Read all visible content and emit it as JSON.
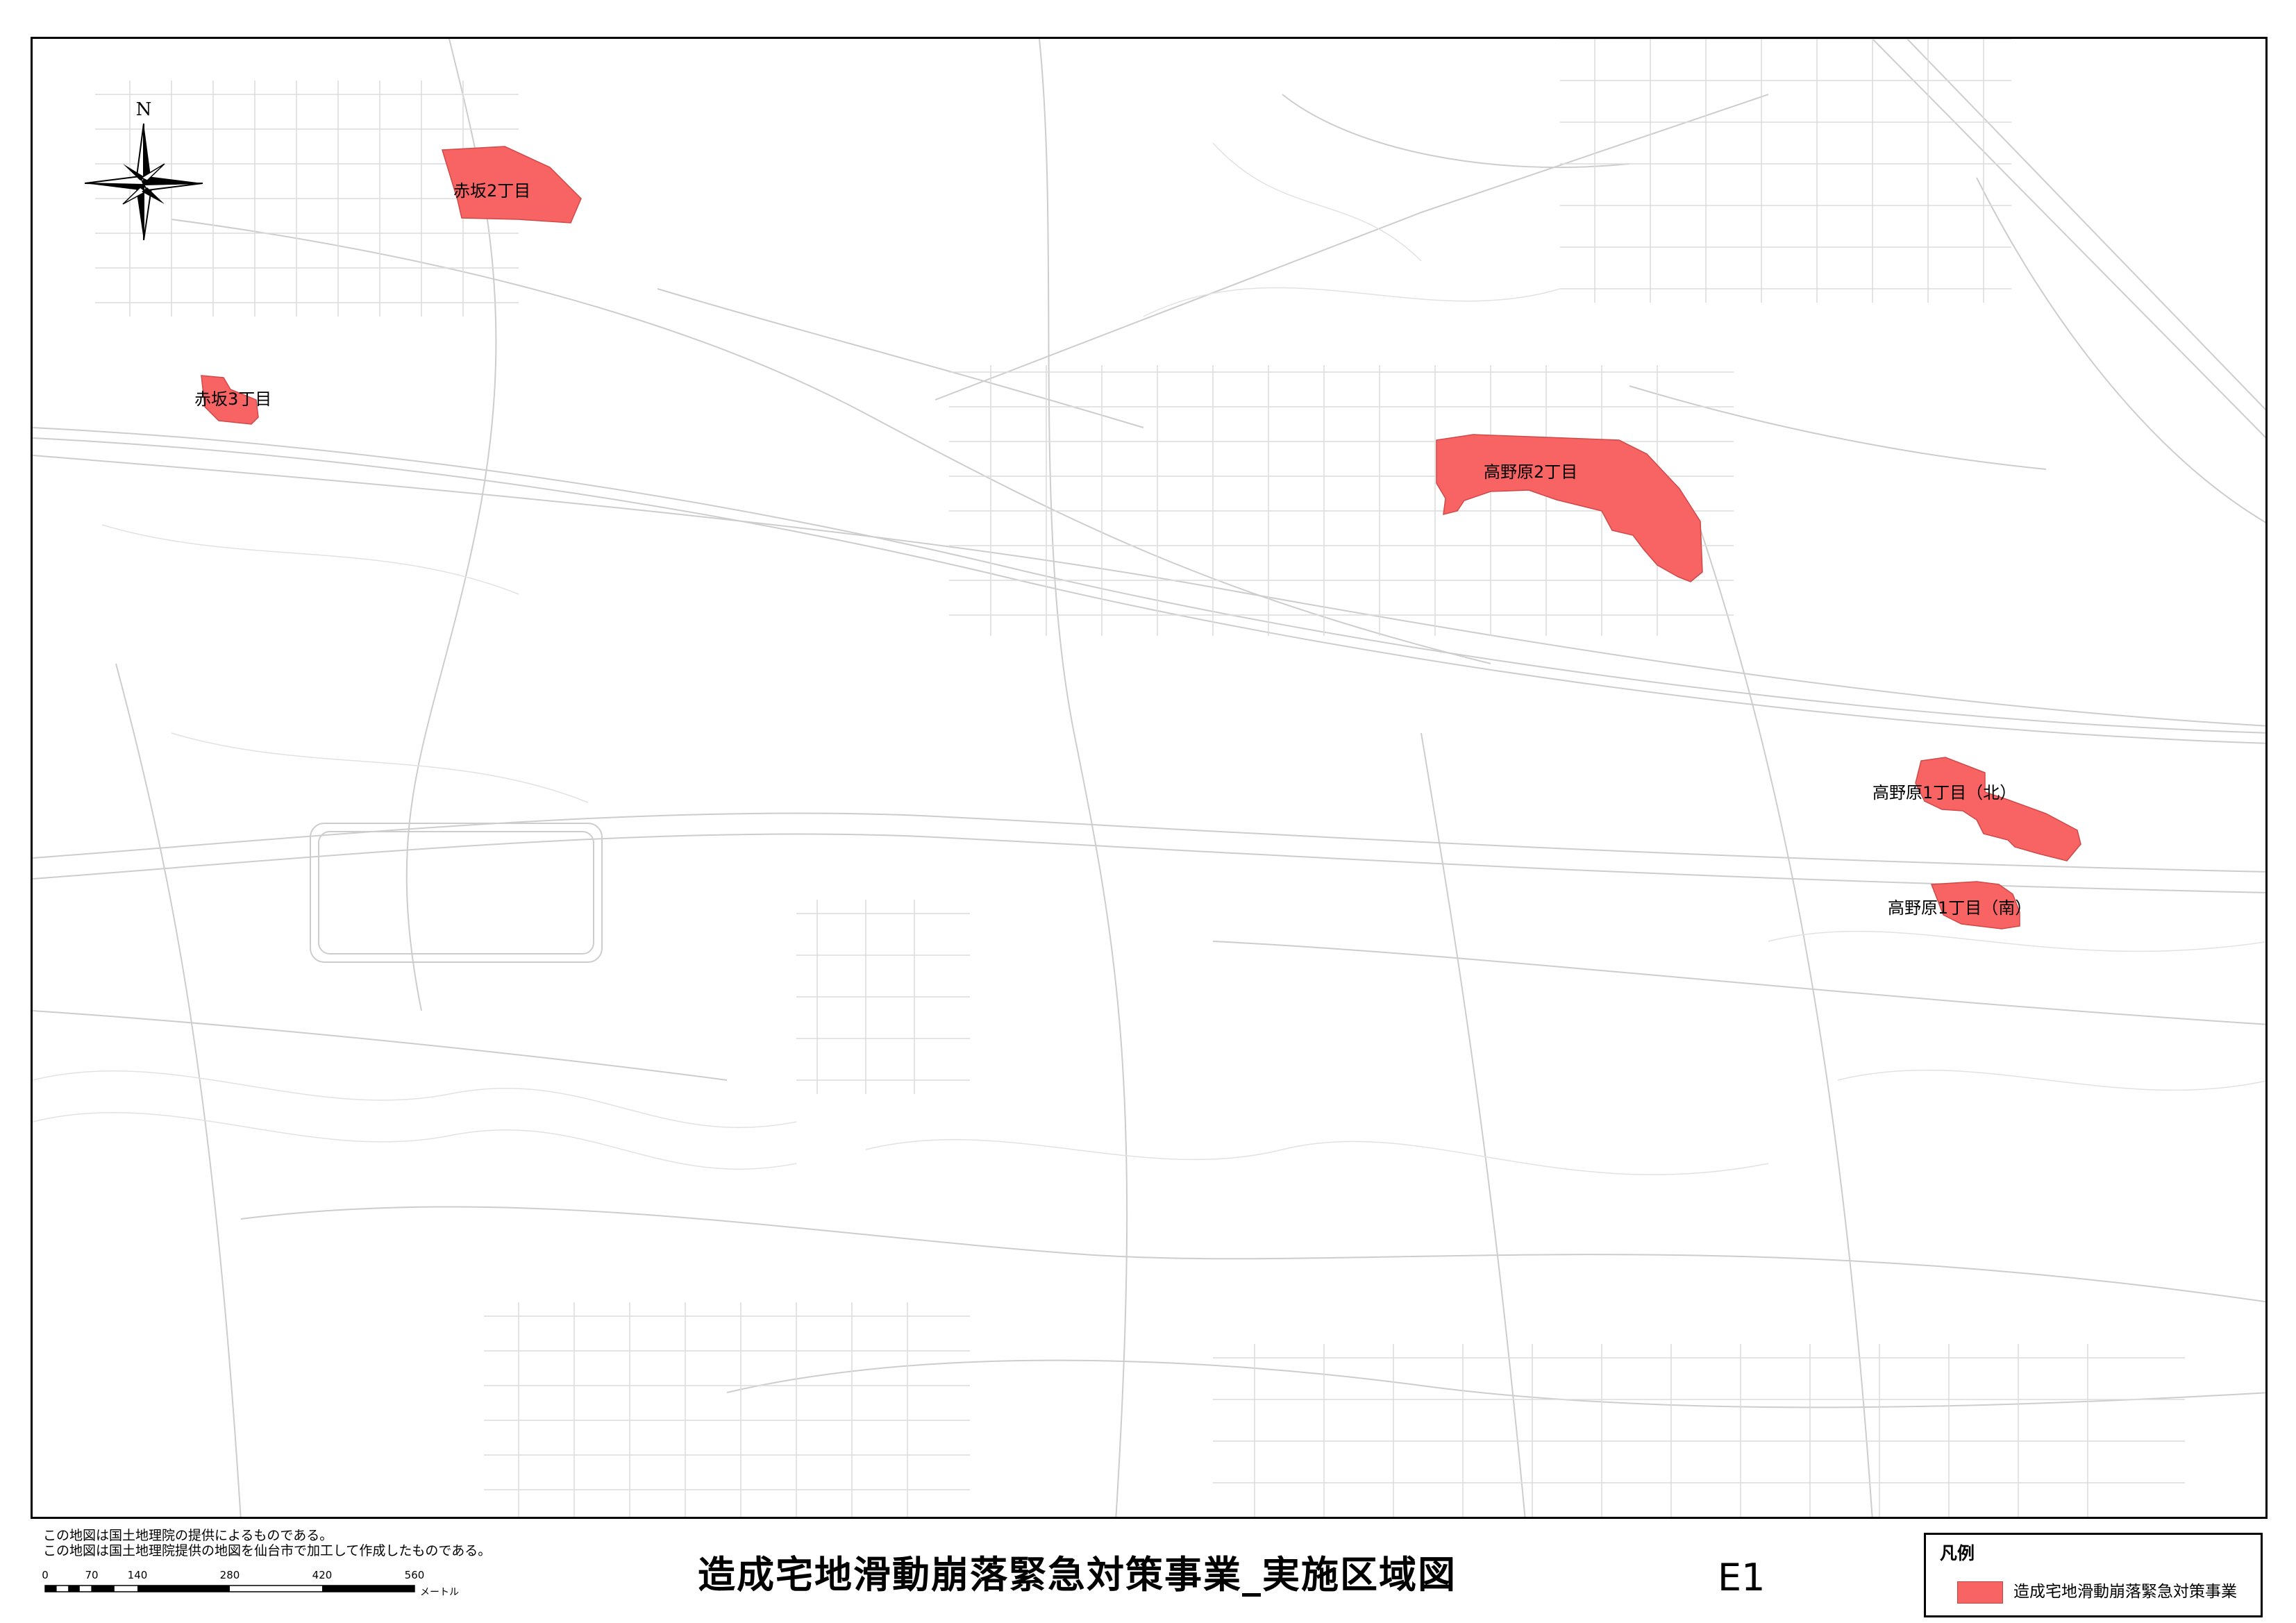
{
  "map": {
    "zone_color": "#F86464",
    "base_line_color": "#cdcdcd",
    "zones": [
      {
        "id": "akasaka-2",
        "label": "赤坂2丁目"
      },
      {
        "id": "akasaka-3",
        "label": "赤坂3丁目"
      },
      {
        "id": "takanohara-2",
        "label": "高野原2丁目"
      },
      {
        "id": "takanohara-1-north",
        "label": "高野原1丁目（北）"
      },
      {
        "id": "takanohara-1-south",
        "label": "高野原1丁目（南）"
      }
    ],
    "north_label": "N"
  },
  "credits": {
    "line1": "この地図は国土地理院の提供によるものである。",
    "line2": "この地図は国土地理院提供の地図を仙台市で加工して作成したものである。"
  },
  "scalebar": {
    "ticks": [
      "0",
      "70",
      "140",
      "280",
      "420",
      "560"
    ],
    "unit": "メートル"
  },
  "title": "造成宅地滑動崩落緊急対策事業_実施区域図",
  "map_code": "E1",
  "legend": {
    "title": "凡例",
    "item_label": "造成宅地滑動崩落緊急対策事業",
    "item_color": "#F86464"
  }
}
